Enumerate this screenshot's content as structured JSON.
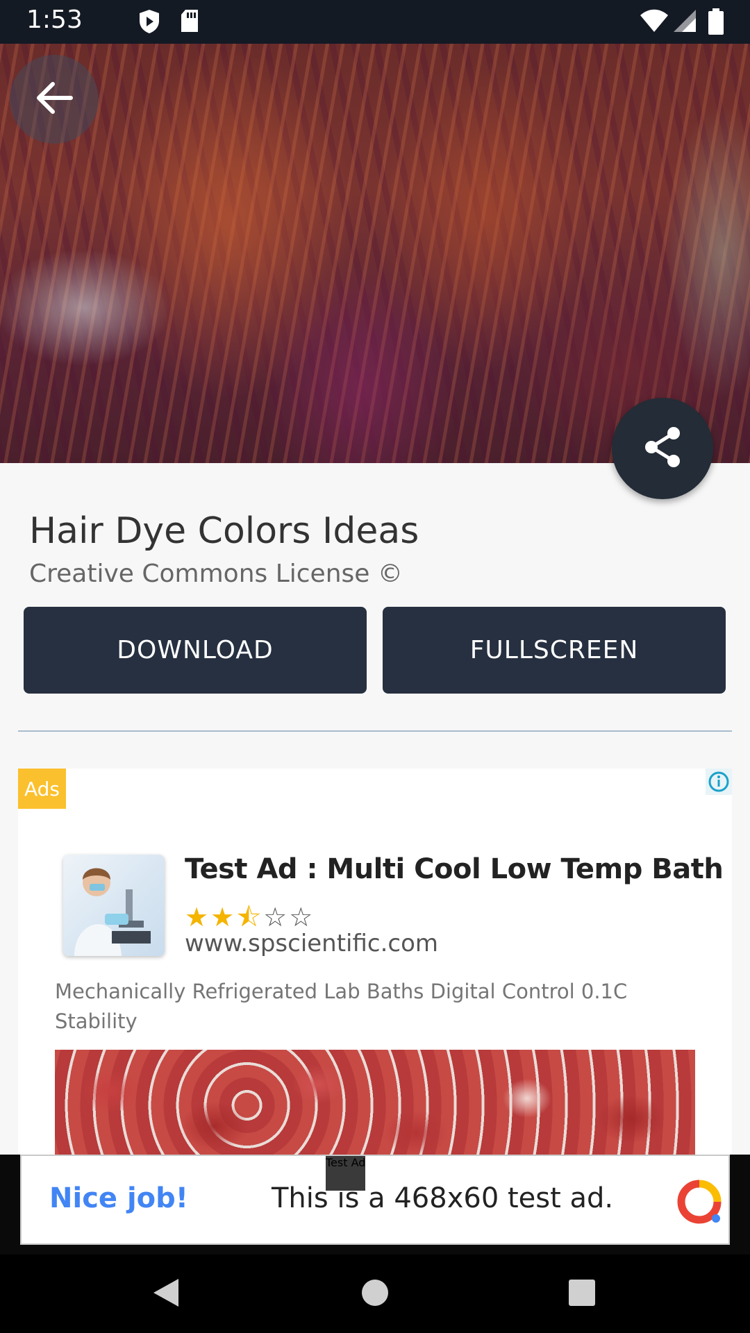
{
  "status_bar": {
    "time": "1:53",
    "icons": [
      "shield-notification-icon",
      "sd-card-icon",
      "wifi-icon",
      "signal-icon",
      "battery-icon"
    ]
  },
  "hero": {
    "alt": "Hair Dye Colors Ideas",
    "back_icon": "arrow-back-icon",
    "share_icon": "share-icon"
  },
  "detail": {
    "title": "Hair Dye Colors Ideas",
    "subtitle": "Creative Commons License ©",
    "download_label": "DOWNLOAD",
    "fullscreen_label": "FULLSCREEN"
  },
  "native_ad": {
    "badge": "Ads",
    "headline": "Test Ad : Multi Cool Low Temp Bath",
    "rating": 2.5,
    "rating_max": 5,
    "stars": [
      "★",
      "★",
      "⯪",
      "☆",
      "☆"
    ],
    "url": "www.spscientific.com",
    "body": "Mechanically Refrigerated Lab Baths Digital Control 0.1C Stability",
    "info_icon": "info-icon"
  },
  "banner_ad": {
    "tag": "Test Ad",
    "nice": "Nice job!",
    "message": "This is a 468x60 test ad."
  },
  "nav": {
    "back": "nav-back-icon",
    "home": "nav-home-icon",
    "recents": "nav-recents-icon"
  },
  "colors": {
    "status_bar_bg": "#141a24",
    "button_bg": "#263040",
    "fab_bg": "#232c37",
    "ads_badge": "#fbc02d",
    "star": "#f4b400",
    "banner_accent": "#4285f4"
  }
}
